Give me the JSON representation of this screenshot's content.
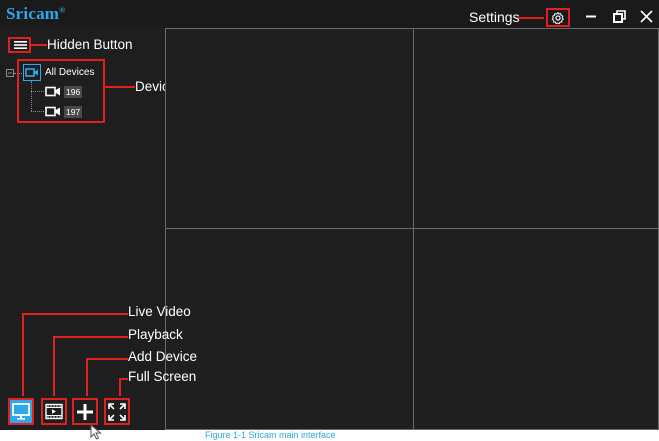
{
  "titlebar": {
    "brand": "Sricam",
    "brand_mark": "®",
    "settings_label": "Settings",
    "icons": [
      "gear-icon",
      "minimize-icon",
      "restore-icon",
      "close-icon"
    ]
  },
  "annotations": {
    "hidden_button": "Hidden Button",
    "device_list": "Device List",
    "live_video": "Live Video",
    "playback": "Playback",
    "add_device": "Add  Device",
    "full_screen": "Full Screen"
  },
  "device_tree": {
    "root_label": "All Devices",
    "devices": [
      {
        "label": "196"
      },
      {
        "label": "197"
      }
    ]
  },
  "video_grid": {
    "rows": 2,
    "cols": 2
  },
  "colors": {
    "accent": "#2da8e8",
    "annotation": "#e02020",
    "background": "#1e1e1e",
    "grid_border": "#6a6a6a"
  },
  "caption": "Figure 1-1  Sricam main interface"
}
